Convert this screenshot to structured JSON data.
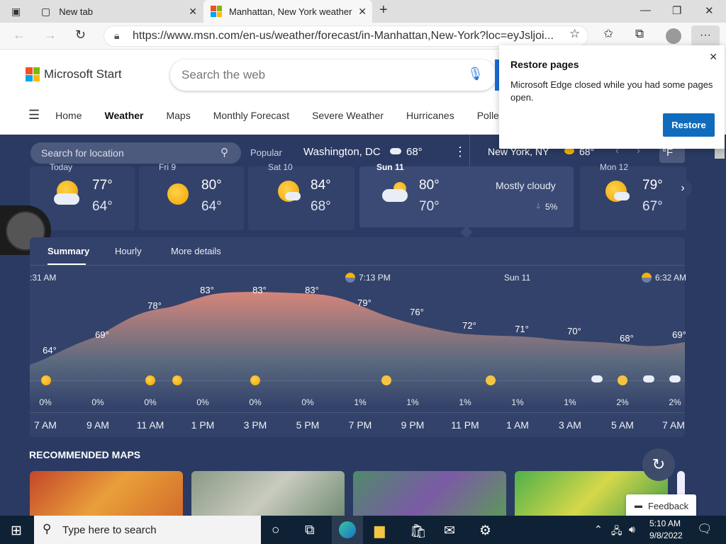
{
  "browser": {
    "tabs": [
      {
        "title": "New tab"
      },
      {
        "title": "Manhattan, New York weather fo"
      }
    ],
    "url": "https://www.msn.com/en-us/weather/forecast/in-Manhattan,New-York?loc=eyJsljoi..."
  },
  "header": {
    "logo_text": "Microsoft Start",
    "search_placeholder": "Search the web",
    "menu": [
      "Home",
      "Weather",
      "Maps",
      "Monthly Forecast",
      "Severe Weather",
      "Hurricanes",
      "Pollen"
    ]
  },
  "weather": {
    "location_search_placeholder": "Search for location",
    "popular_label": "Popular",
    "popular_city": "Washington, DC",
    "popular_temp": "68°",
    "current_city": "New York, NY",
    "current_temp": "68°",
    "unit": "°F",
    "days": [
      {
        "label": "Today",
        "hi": "77°",
        "lo": "64°",
        "icon": "partly-sunny-icon"
      },
      {
        "label": "Fri 9",
        "hi": "80°",
        "lo": "64°",
        "icon": "sunny-icon"
      },
      {
        "label": "Sat 10",
        "hi": "84°",
        "lo": "68°",
        "icon": "partly-sunny-icon"
      },
      {
        "label": "Sun 11",
        "hi": "80°",
        "lo": "70°",
        "icon": "mostly-cloudy-icon",
        "condition": "Mostly cloudy",
        "precip": "5%"
      },
      {
        "label": "Mon 12",
        "hi": "79°",
        "lo": "67°",
        "icon": "partly-sunny-icon"
      }
    ],
    "tabs": [
      "Summary",
      "Hourly",
      "More details"
    ],
    "timeline_labels": {
      "start": ":31 AM",
      "sunset": "7:13 PM",
      "day": "Sun 11",
      "sunrise": "6:32 AM"
    },
    "hourly_temps": [
      "64°",
      "69°",
      "78°",
      "83°",
      "83°",
      "83°",
      "79°",
      "76°",
      "72°",
      "71°",
      "70°",
      "68°",
      "69°"
    ],
    "hourly_precip": [
      "0%",
      "0%",
      "0%",
      "0%",
      "0%",
      "0%",
      "1%",
      "1%",
      "1%",
      "1%",
      "1%",
      "2%",
      "2%"
    ],
    "hours": [
      "7 AM",
      "9 AM",
      "11 AM",
      "1 PM",
      "3 PM",
      "5 PM",
      "7 PM",
      "9 PM",
      "11 PM",
      "1 AM",
      "3 AM",
      "5 AM",
      "7 AM"
    ],
    "recommended_maps_title": "RECOMMENDED MAPS"
  },
  "restore_popup": {
    "title": "Restore pages",
    "message": "Microsoft Edge closed while you had some pages open.",
    "button": "Restore"
  },
  "feedback_label": "Feedback",
  "taskbar": {
    "search_placeholder": "Type here to search",
    "time": "5:10 AM",
    "date": "9/8/2022"
  }
}
